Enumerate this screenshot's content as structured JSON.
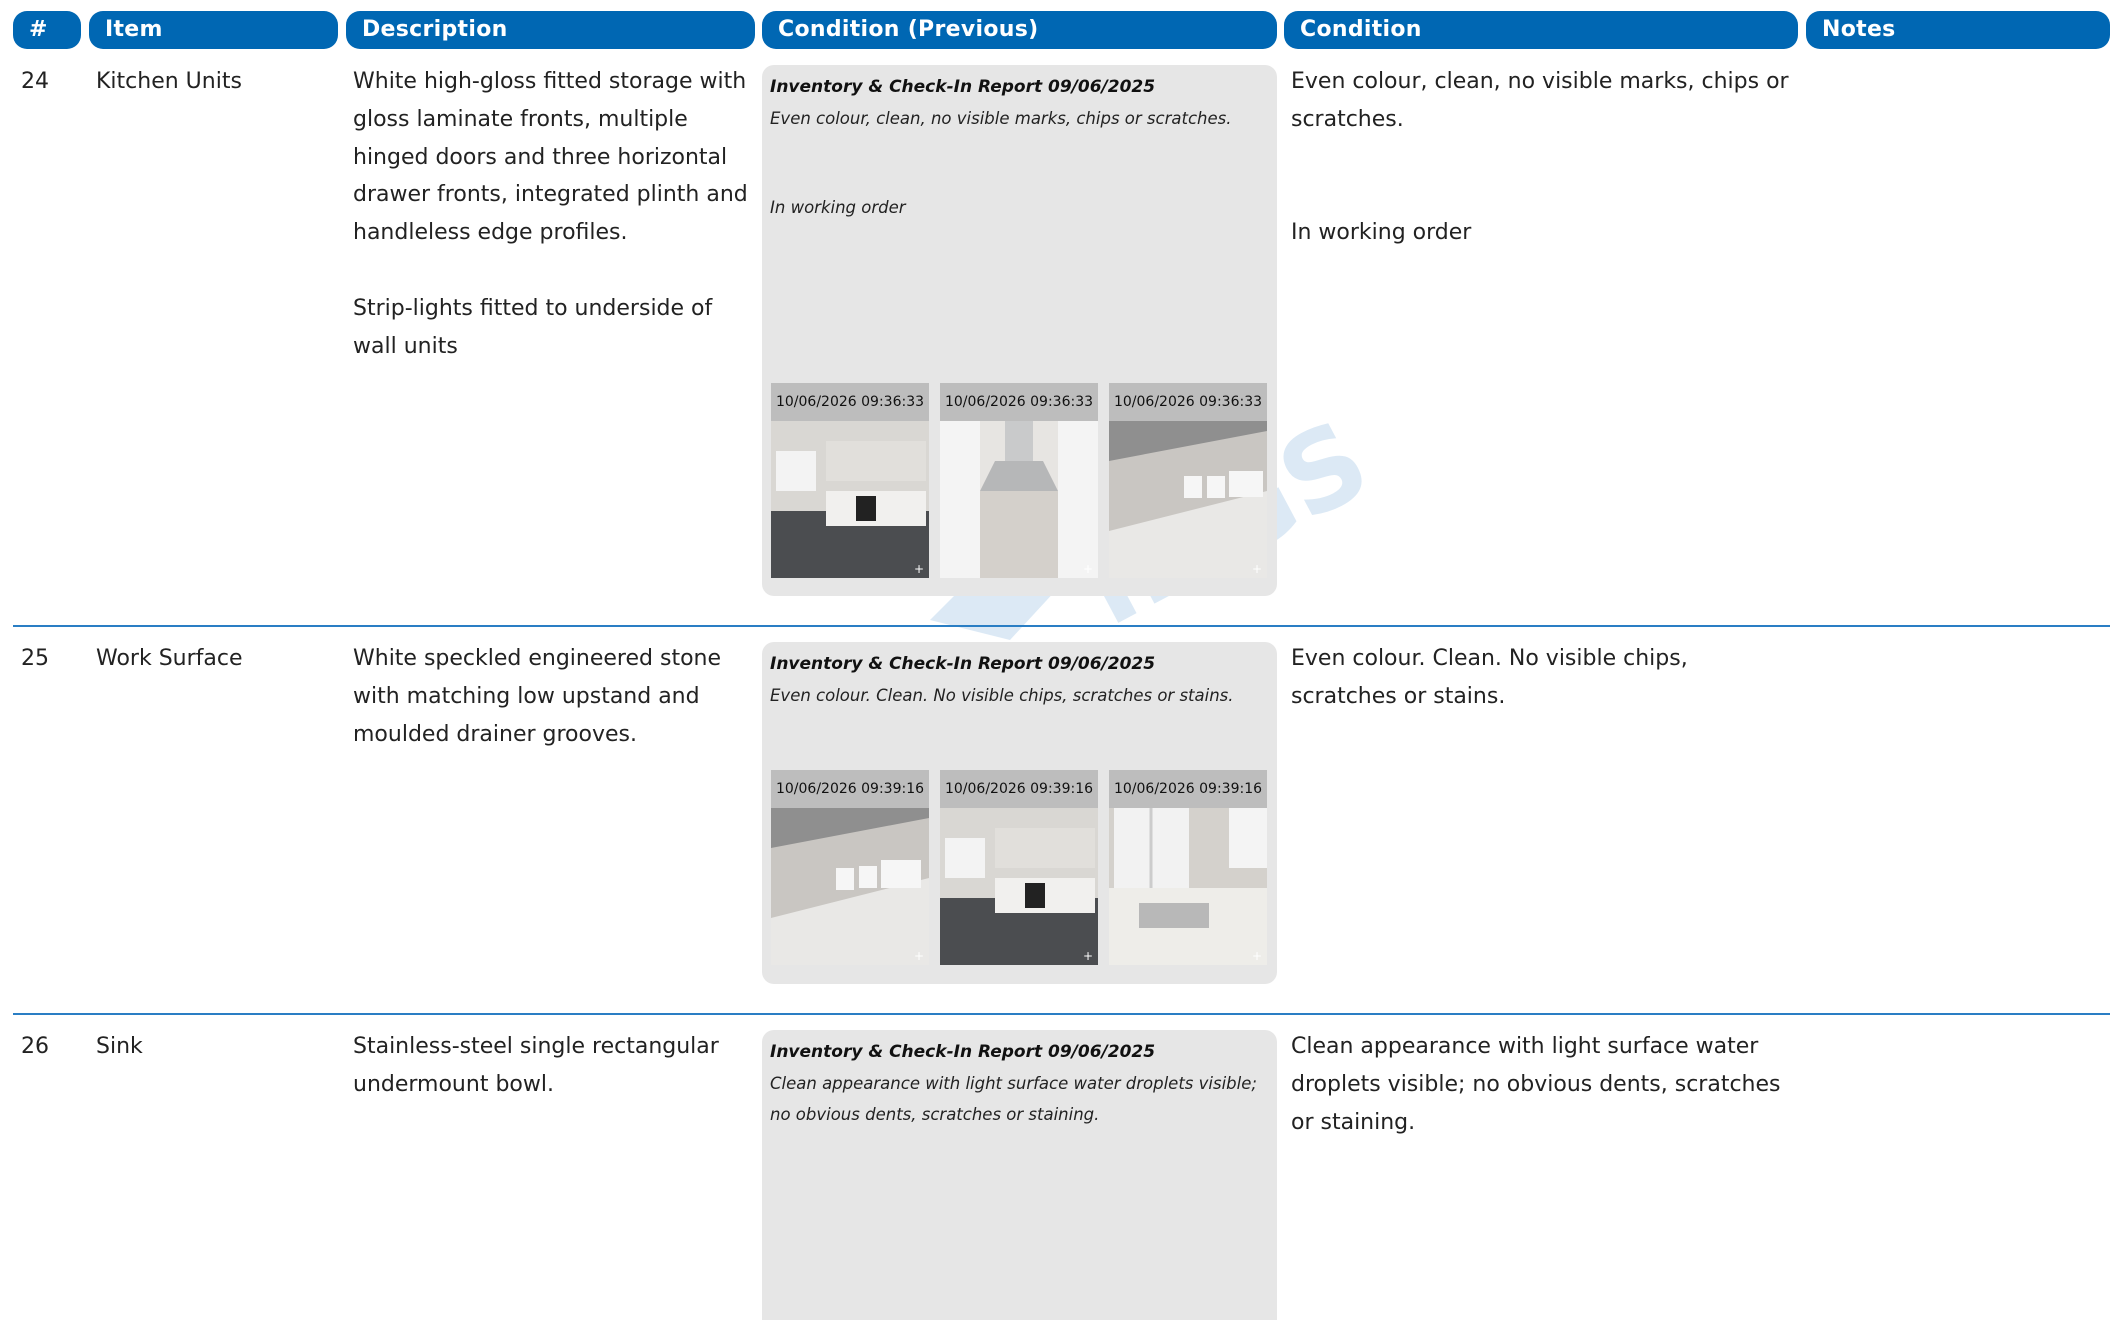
{
  "columns": {
    "num": "#",
    "item": "Item",
    "description": "Description",
    "condition_previous": "Condition (Previous)",
    "condition": "Condition",
    "notes": "Notes"
  },
  "rows": [
    {
      "num": "24",
      "item": "Kitchen Units",
      "description": [
        "White high-gloss fitted storage with gloss laminate fronts, multiple hinged doors and three horizontal drawer fronts, integrated plinth and handleless edge profiles.",
        "Strip-lights fitted to underside of wall units"
      ],
      "prev_report": "Inventory & Check-In Report 09/06/2025",
      "prev_condition": "Even colour, clean, no visible marks, chips or scratches.",
      "prev_working": "In working order",
      "photos": [
        "10/06/2026 09:36:33",
        "10/06/2026 09:36:33",
        "10/06/2026 09:36:33"
      ],
      "condition": "Even colour, clean, no visible marks, chips or scratches.",
      "working": "In working order",
      "notes": ""
    },
    {
      "num": "25",
      "item": "Work Surface",
      "description": [
        "White speckled engineered stone with matching low upstand and moulded drainer grooves."
      ],
      "prev_report": "Inventory & Check-In Report 09/06/2025",
      "prev_condition": "Even colour. Clean. No visible chips, scratches or stains.",
      "photos": [
        "10/06/2026 09:39:16",
        "10/06/2026 09:39:16",
        "10/06/2026 09:39:16"
      ],
      "condition": "Even colour. Clean. No visible chips, scratches or stains.",
      "notes": ""
    },
    {
      "num": "26",
      "item": "Sink",
      "description": [
        "Stainless-steel single rectangular undermount bowl."
      ],
      "prev_report": "Inventory & Check-In Report 09/06/2025",
      "prev_condition": "Clean appearance with light surface water droplets visible; no obvious dents, scratches or staining.",
      "condition": "Clean appearance with light surface water droplets visible; no obvious dents, scratches or staining.",
      "notes": ""
    }
  ],
  "watermark": "INGS",
  "colors": {
    "header_bg": "#0067b3",
    "separator": "#2a7ec4",
    "prev_bg": "#e6e6e6"
  }
}
